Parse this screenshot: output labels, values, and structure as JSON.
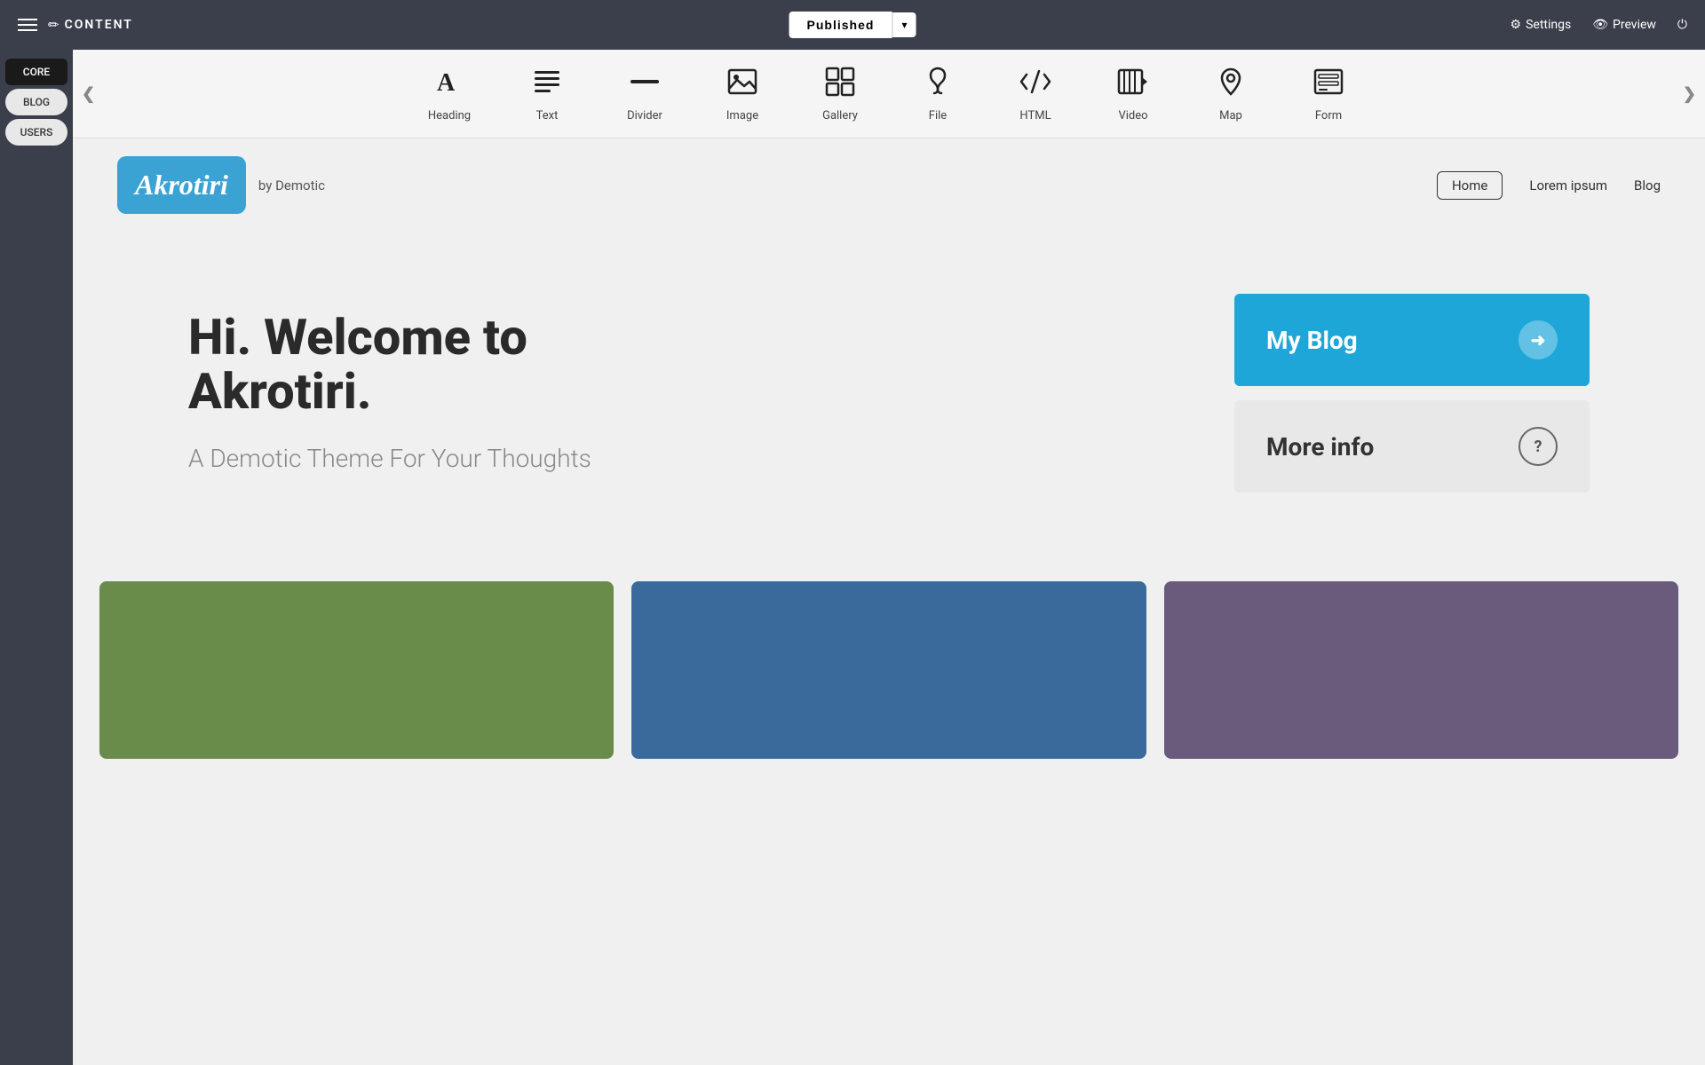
{
  "topbar": {
    "title": "CONTENT",
    "title_icon": "✏",
    "publish_label": "Published",
    "dropdown_arrow": "▾",
    "settings_label": "Settings",
    "preview_label": "Preview",
    "settings_icon": "⚙",
    "preview_icon": "👁",
    "power_icon": "⏻"
  },
  "sidebar": {
    "items": [
      {
        "label": "CORE",
        "state": "active"
      },
      {
        "label": "BLOG",
        "state": "light"
      },
      {
        "label": "USERS",
        "state": "light"
      }
    ]
  },
  "toolbar": {
    "left_arrow": "❮",
    "right_arrow": "❯",
    "items": [
      {
        "label": "Heading",
        "icon": "heading"
      },
      {
        "label": "Text",
        "icon": "text"
      },
      {
        "label": "Divider",
        "icon": "divider"
      },
      {
        "label": "Image",
        "icon": "image"
      },
      {
        "label": "Gallery",
        "icon": "gallery"
      },
      {
        "label": "File",
        "icon": "file"
      },
      {
        "label": "HTML",
        "icon": "html"
      },
      {
        "label": "Video",
        "icon": "video"
      },
      {
        "label": "Map",
        "icon": "map"
      },
      {
        "label": "Form",
        "icon": "form"
      }
    ]
  },
  "site_header": {
    "logo_text": "Akrotiri",
    "by_text": "by Demotic",
    "nav_items": [
      {
        "label": "Home",
        "active": true
      },
      {
        "label": "Lorem ipsum",
        "active": false
      },
      {
        "label": "Blog",
        "active": false
      }
    ]
  },
  "hero": {
    "title": "Hi. Welcome to Akrotiri.",
    "subtitle": "A Demotic Theme For Your Thoughts",
    "primary_btn_label": "My Blog",
    "primary_btn_icon": "➜",
    "secondary_btn_label": "More info",
    "secondary_btn_icon": "?"
  },
  "cards": [
    {
      "color": "green"
    },
    {
      "color": "blue"
    },
    {
      "color": "purple"
    }
  ]
}
